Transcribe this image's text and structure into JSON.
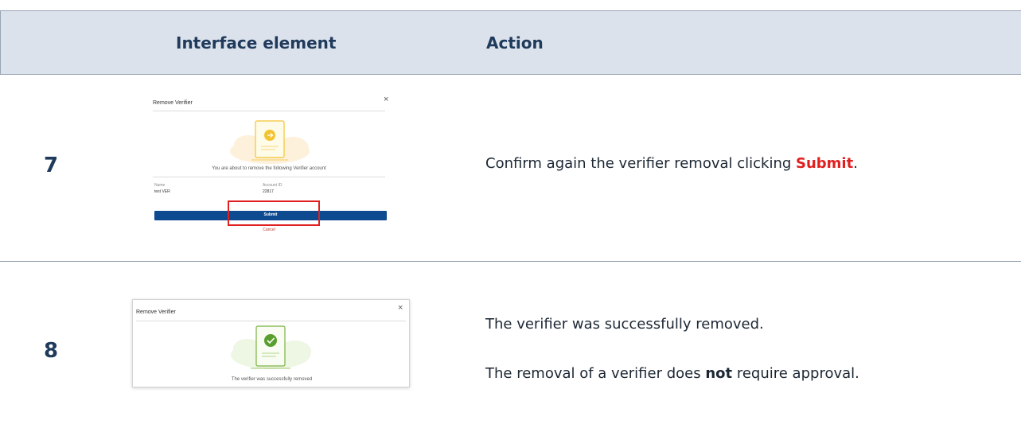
{
  "header": {
    "col_element": "Interface element",
    "col_action": "Action"
  },
  "rows": [
    {
      "step": "7",
      "dialog": {
        "title": "Remove Verifier",
        "close": "×",
        "message": "You are about to remove the following Verifier account",
        "name_label": "Name",
        "name_value": "test VER",
        "account_label": "Account ID",
        "account_value": "22817",
        "submit_label": "Submit",
        "cancel_label": "Cancel"
      },
      "action": {
        "text_before": "Confirm again the verifier removal clicking ",
        "highlight": "Submit",
        "text_after": "."
      }
    },
    {
      "step": "8",
      "dialog": {
        "title": "Remove Verifier",
        "close": "×",
        "message": "The verifier was successfully removed"
      },
      "action": {
        "line1": "The verifier was successfully removed.",
        "line2_before": "The removal of a verifier does ",
        "line2_bold": "not",
        "line2_after": " require approval."
      }
    }
  ],
  "colors": {
    "header_bg": "#dbe2ec",
    "heading_text": "#1f3a5b",
    "highlight_red": "#e02020",
    "submit_blue": "#0e4a8f",
    "doc_yellow": "#f3c431",
    "success_green": "#7cb342"
  }
}
